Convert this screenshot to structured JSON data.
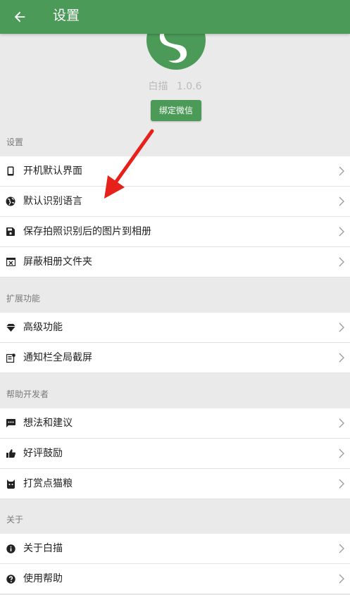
{
  "appbar": {
    "title": "设置",
    "back_icon": "arrow-left-icon"
  },
  "profile": {
    "app_name": "白描",
    "version": "1.0.6",
    "bind_button": "绑定微信",
    "logo_color": "#4b9a58"
  },
  "sections": [
    {
      "header": "设置",
      "items": [
        {
          "label": "开机默认界面",
          "icon": "phone-icon"
        },
        {
          "label": "默认识别语言",
          "icon": "globe-icon"
        },
        {
          "label": "保存拍照识别后的图片到相册",
          "icon": "save-icon"
        },
        {
          "label": "屏蔽相册文件夹",
          "icon": "hidden-folder-icon"
        }
      ]
    },
    {
      "header": "扩展功能",
      "items": [
        {
          "label": "高级功能",
          "icon": "diamond-icon"
        },
        {
          "label": "通知栏全局截屏",
          "icon": "notification-screenshot-icon"
        }
      ]
    },
    {
      "header": "帮助开发者",
      "items": [
        {
          "label": "想法和建议",
          "icon": "feedback-icon"
        },
        {
          "label": "好评鼓励",
          "icon": "thumbs-up-icon"
        },
        {
          "label": "打赏点猫粮",
          "icon": "cat-icon"
        }
      ]
    },
    {
      "header": "关于",
      "items": [
        {
          "label": "关于白描",
          "icon": "info-icon"
        },
        {
          "label": "使用帮助",
          "icon": "help-icon"
        }
      ]
    }
  ],
  "colors": {
    "primary": "#4b9a58",
    "annotation_arrow": "#e8201c"
  }
}
